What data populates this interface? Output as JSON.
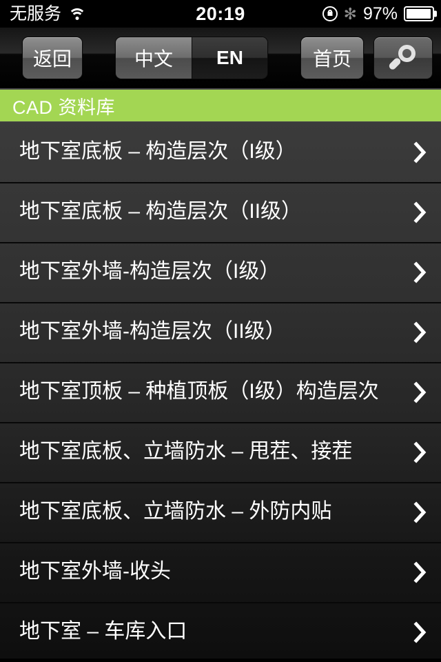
{
  "statusbar": {
    "carrier": "无服务",
    "wifi_icon": "wifi-icon",
    "time": "20:19",
    "rotation_lock_icon": "rotation-lock-icon",
    "bluetooth_icon": "bluetooth-icon",
    "bluetooth_glyph": "✻",
    "battery_percent": "97%",
    "battery_level": 97,
    "battery_icon": "battery-icon"
  },
  "toolbar": {
    "back_label": "返回",
    "home_label": "首页",
    "search_icon": "search-icon",
    "language_segments": [
      {
        "label": "中文",
        "selected": true
      },
      {
        "label": "EN",
        "selected": false
      }
    ]
  },
  "section": {
    "title": "CAD 资料库",
    "accent_color": "#a3d653"
  },
  "list": {
    "chevron_icon": "chevron-right-icon",
    "items": [
      {
        "label": "地下室底板 – 构造层次（I级）"
      },
      {
        "label": "地下室底板 – 构造层次（II级）"
      },
      {
        "label": "地下室外墙-构造层次（I级）"
      },
      {
        "label": "地下室外墙-构造层次（II级）"
      },
      {
        "label": "地下室顶板 – 种植顶板（I级）构造层次"
      },
      {
        "label": "地下室底板、立墙防水 – 甩茬、接茬"
      },
      {
        "label": "地下室底板、立墙防水 – 外防内贴"
      },
      {
        "label": "地下室外墙-收头"
      },
      {
        "label": "地下室 – 车库入口"
      }
    ]
  }
}
